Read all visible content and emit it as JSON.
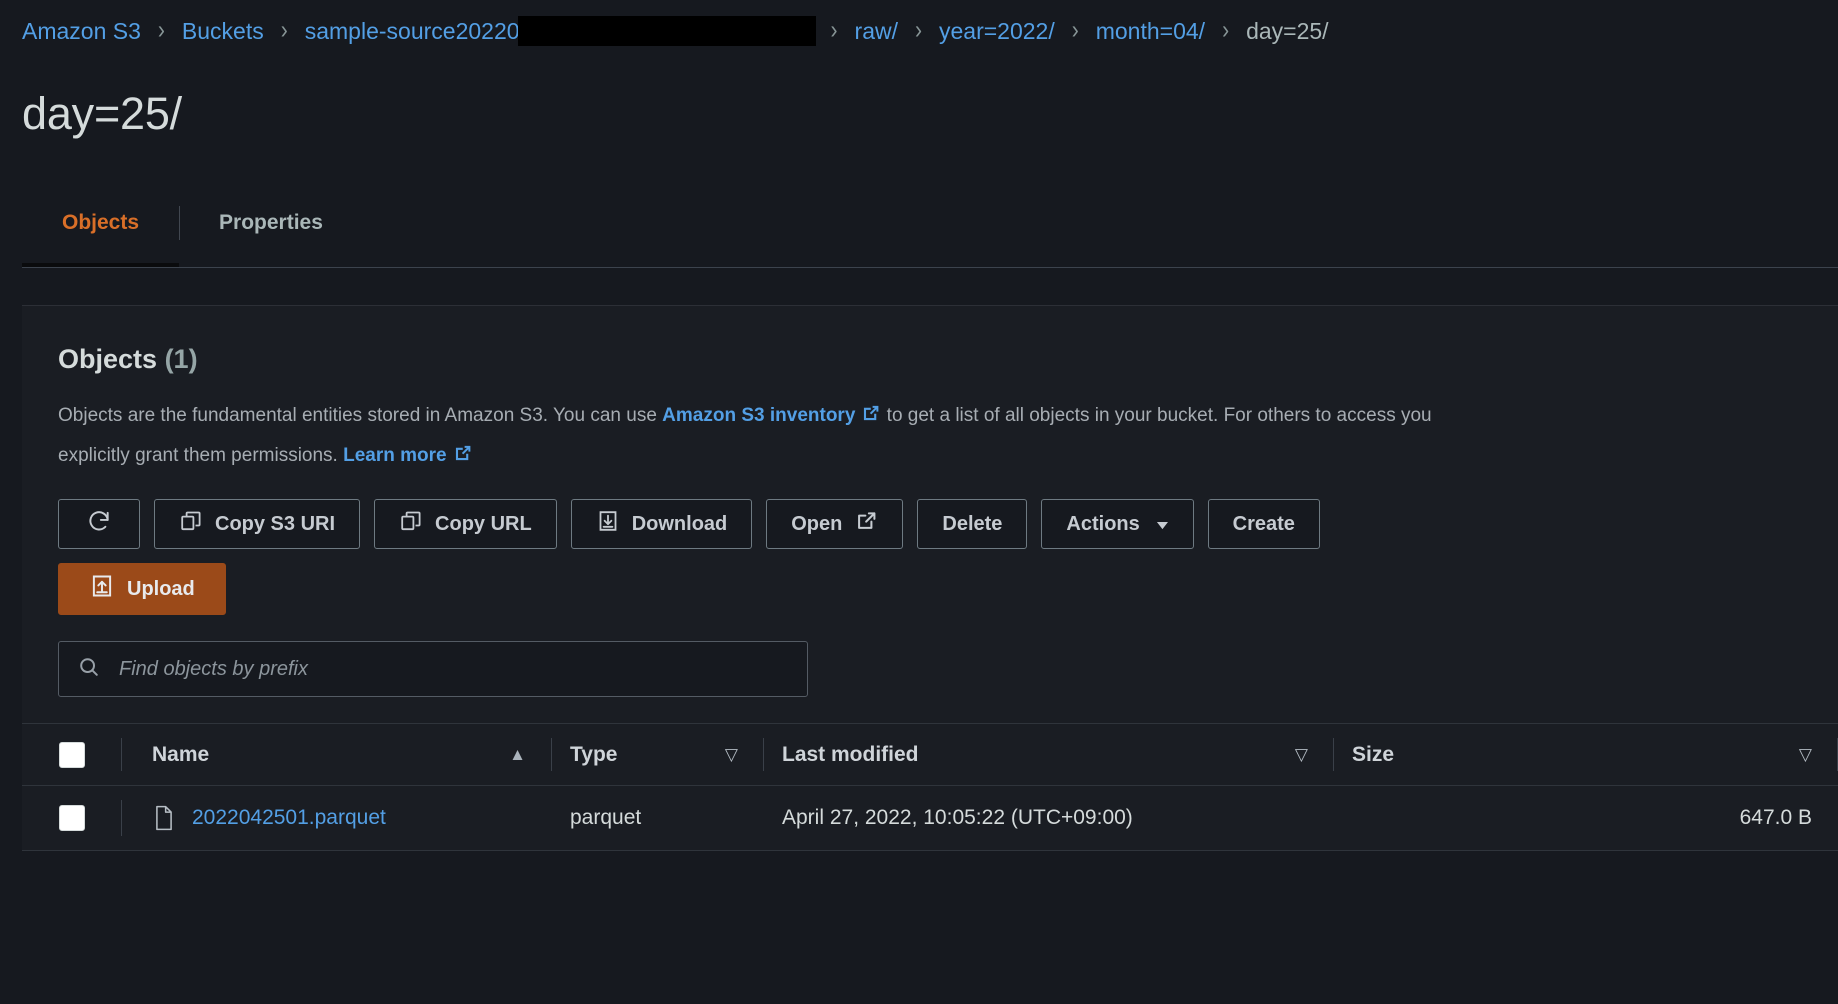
{
  "breadcrumb": {
    "items": [
      {
        "label": "Amazon S3",
        "type": "link"
      },
      {
        "label": "Buckets",
        "type": "link"
      },
      {
        "label": "sample-source20220",
        "type": "link",
        "redacted": true
      },
      {
        "label": "raw/",
        "type": "link"
      },
      {
        "label": "year=2022/",
        "type": "link"
      },
      {
        "label": "month=04/",
        "type": "link"
      },
      {
        "label": "day=25/",
        "type": "current"
      }
    ],
    "separator": "›"
  },
  "page": {
    "title": "day=25/"
  },
  "tabs": [
    {
      "label": "Objects",
      "active": true
    },
    {
      "label": "Properties",
      "active": false
    }
  ],
  "objects_panel": {
    "title": "Objects",
    "count": "(1)",
    "description_part1": "Objects are the fundamental entities stored in Amazon S3. You can use ",
    "inventory_link": "Amazon S3 inventory",
    "description_part2": " to get a list of all objects in your bucket. For others to access you",
    "description_part3": "explicitly grant them permissions. ",
    "learn_more_link": "Learn more",
    "toolbar": {
      "refresh_label": "",
      "copy_s3_uri_label": "Copy S3 URI",
      "copy_url_label": "Copy URL",
      "download_label": "Download",
      "open_label": "Open",
      "delete_label": "Delete",
      "actions_label": "Actions",
      "actions_caret": "▼",
      "create_label": "Create",
      "upload_label": "Upload"
    },
    "search": {
      "placeholder": "Find objects by prefix",
      "value": ""
    },
    "table": {
      "columns": [
        {
          "label": "Name",
          "sort": "▲"
        },
        {
          "label": "Type",
          "sort": "▽"
        },
        {
          "label": "Last modified",
          "sort": "▽"
        },
        {
          "label": "Size",
          "sort": "▽"
        }
      ],
      "rows": [
        {
          "name": "2022042501.parquet",
          "type": "parquet",
          "last_modified": "April 27, 2022, 10:05:22 (UTC+09:00)",
          "size": "647.0 B"
        }
      ]
    }
  },
  "colors": {
    "background": "#16191f",
    "panel": "#1a1d23",
    "link": "#539fe5",
    "accent_orange": "#d96f28",
    "upload_button": "#9b4a19",
    "text": "#d5dbdb",
    "muted_text": "#a7adb3"
  }
}
